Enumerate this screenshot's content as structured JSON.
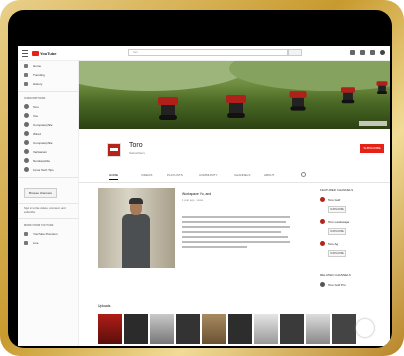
{
  "topbar": {
    "logo_text": "YouTube",
    "search_placeholder": "toro"
  },
  "sidebar": {
    "items": [
      {
        "label": "Home"
      },
      {
        "label": "Trending"
      },
      {
        "label": "History"
      }
    ],
    "subscriptions_heading": "SUBSCRIPTIONS",
    "subscriptions": [
      {
        "label": "Toro"
      },
      {
        "label": "Vox"
      },
      {
        "label": "Computerphile"
      },
      {
        "label": "Wired"
      },
      {
        "label": "Computerphile"
      },
      {
        "label": "Veritasium"
      },
      {
        "label": "Numberphile"
      },
      {
        "label": "Linus Tech Tips"
      }
    ],
    "browse_button": "Browse channels",
    "note": "Sign in to like videos, comment, and subscribe.",
    "more_heading": "MORE FROM YOUTUBE",
    "more_items": [
      {
        "label": "YouTube Premium"
      },
      {
        "label": "Live"
      }
    ]
  },
  "channel": {
    "name": "Toro",
    "subscribers": "Subscribers",
    "subscribe_label": "SUBSCRIBE"
  },
  "tabs": [
    {
      "label": "HOME"
    },
    {
      "label": "VIDEOS"
    },
    {
      "label": "PLAYLISTS"
    },
    {
      "label": "COMMUNITY"
    },
    {
      "label": "CHANNELS"
    },
    {
      "label": "ABOUT"
    }
  ],
  "featured": {
    "title": "Workspace Yo, and",
    "meta": "1 year ago · views"
  },
  "right_column": {
    "heading": "FEATURED CHANNELS",
    "channels": [
      {
        "name": "Toro Golf",
        "button": "SUBSCRIBE"
      },
      {
        "name": "Toro Landscape",
        "button": "SUBSCRIBE"
      },
      {
        "name": "Toro Ag",
        "button": "SUBSCRIBE"
      }
    ],
    "related_heading": "RELATED CHANNELS",
    "related": [
      {
        "name": "Toro Golf Pro"
      }
    ]
  },
  "uploads": {
    "title": "Uploads"
  },
  "colors": {
    "brand_red": "#e62117",
    "banner_green": "#6e8b3e",
    "frame_gold": "#c89a2e"
  }
}
